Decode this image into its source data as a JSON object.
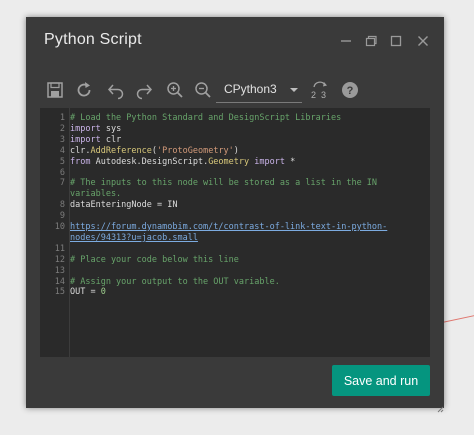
{
  "window": {
    "title": "Python Script",
    "controls": [
      "minimize-icon",
      "restore-icon",
      "maximize-icon",
      "close-icon"
    ]
  },
  "toolbar": {
    "icons": [
      "save-icon",
      "run-icon",
      "undo-icon",
      "redo-icon",
      "zoom-in-icon",
      "zoom-out-icon",
      "convert-2to3-icon",
      "help-icon"
    ],
    "engine": "CPython3",
    "convert_label": "2 3"
  },
  "editor": {
    "line_numbers": [
      "1",
      "2",
      "3",
      "4",
      "5",
      "6",
      "7",
      "",
      "8",
      "9",
      "10",
      "",
      "11",
      "12",
      "13",
      "14",
      "15"
    ],
    "lines": [
      {
        "parts": [
          {
            "c": "cmt",
            "t": "# Load the Python Standard and DesignScript Libraries"
          }
        ]
      },
      {
        "parts": [
          {
            "c": "kw",
            "t": "import"
          },
          {
            "c": "",
            "t": " sys"
          }
        ]
      },
      {
        "parts": [
          {
            "c": "kw",
            "t": "import"
          },
          {
            "c": "",
            "t": " clr"
          }
        ]
      },
      {
        "parts": [
          {
            "c": "",
            "t": "clr."
          },
          {
            "c": "fn",
            "t": "AddReference"
          },
          {
            "c": "",
            "t": "("
          },
          {
            "c": "str",
            "t": "'ProtoGeometry'"
          },
          {
            "c": "",
            "t": ")"
          }
        ]
      },
      {
        "parts": [
          {
            "c": "kw",
            "t": "from"
          },
          {
            "c": "",
            "t": " Autodesk.DesignScript."
          },
          {
            "c": "fn",
            "t": "Geometry"
          },
          {
            "c": "",
            "t": " "
          },
          {
            "c": "kw",
            "t": "import"
          },
          {
            "c": "",
            "t": " *"
          }
        ]
      },
      {
        "parts": []
      },
      {
        "parts": [
          {
            "c": "cmt",
            "t": "# The inputs to this node will be stored as a list in the IN"
          }
        ]
      },
      {
        "parts": [
          {
            "c": "cmt",
            "t": "variables."
          }
        ]
      },
      {
        "parts": [
          {
            "c": "",
            "t": "dataEnteringNode = IN"
          }
        ]
      },
      {
        "parts": []
      },
      {
        "parts": [
          {
            "c": "url",
            "t": "https://forum.dynamobim.com/t/contrast-of-link-text-in-python-"
          }
        ]
      },
      {
        "parts": [
          {
            "c": "url",
            "t": "nodes/94313?u=jacob.small"
          }
        ]
      },
      {
        "parts": []
      },
      {
        "parts": [
          {
            "c": "cmt",
            "t": "# Place your code below this line"
          }
        ]
      },
      {
        "parts": []
      },
      {
        "parts": [
          {
            "c": "cmt",
            "t": "# Assign your output to the OUT variable."
          }
        ]
      },
      {
        "parts": [
          {
            "c": "",
            "t": "OUT = "
          },
          {
            "c": "num",
            "t": "0"
          }
        ]
      }
    ]
  },
  "actions": {
    "run_label": "Save and run"
  },
  "colors": {
    "accent": "#05957f",
    "window_bg": "#3a3a3a",
    "editor_bg": "#2a2a2a"
  }
}
